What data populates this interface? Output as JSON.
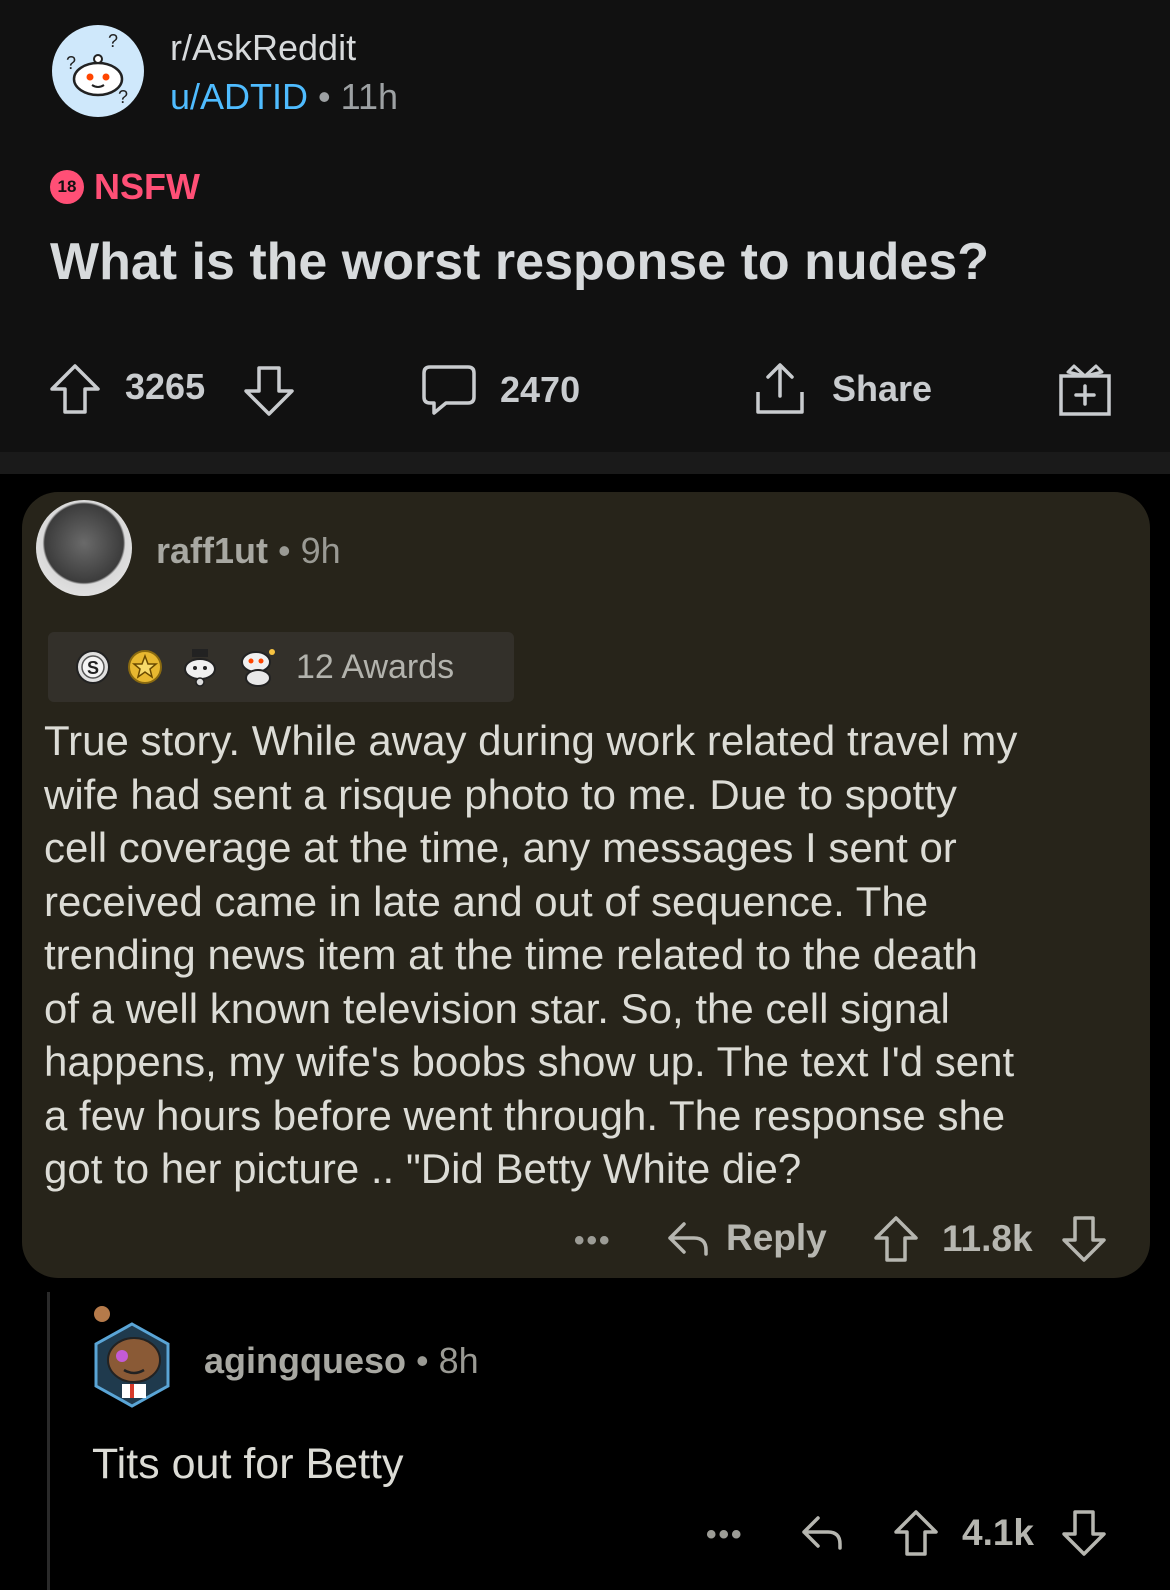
{
  "post": {
    "subreddit": "r/AskReddit",
    "author": "u/ADTID",
    "separator": "•",
    "age": "11h",
    "nsfw_badge": "18",
    "nsfw_label": "NSFW",
    "title": "What is the worst response to nudes?",
    "upvotes": "3265",
    "comments": "2470",
    "share_label": "Share"
  },
  "comment": {
    "author": "raff1ut",
    "separator": "•",
    "age": "9h",
    "awards_label": "12 Awards",
    "body": "True story. While away during work related travel my\nwife had sent a risque photo to me. Due to spotty\ncell coverage at the time, any messages I sent or\nreceived came in late and out of sequence.  The\ntrending news item at the time related to the death\nof a well known television star.  So, the cell signal\nhappens, my wife's boobs show up. The text I'd sent\na few hours before went through. The response she\ngot to her picture .. \"Did Betty White die?",
    "more": "•••",
    "reply_label": "Reply",
    "votes": "11.8k"
  },
  "reply": {
    "author": "agingqueso",
    "separator": "•",
    "age": "8h",
    "body": "Tits out for Betty",
    "more": "•••",
    "votes": "4.1k"
  },
  "colors": {
    "background": "#000000",
    "post_bg": "#111111",
    "comment_card": "#27241a",
    "link_blue": "#4fbcff",
    "nsfw_pink": "#ff4f76",
    "text": "#d7dadc"
  }
}
